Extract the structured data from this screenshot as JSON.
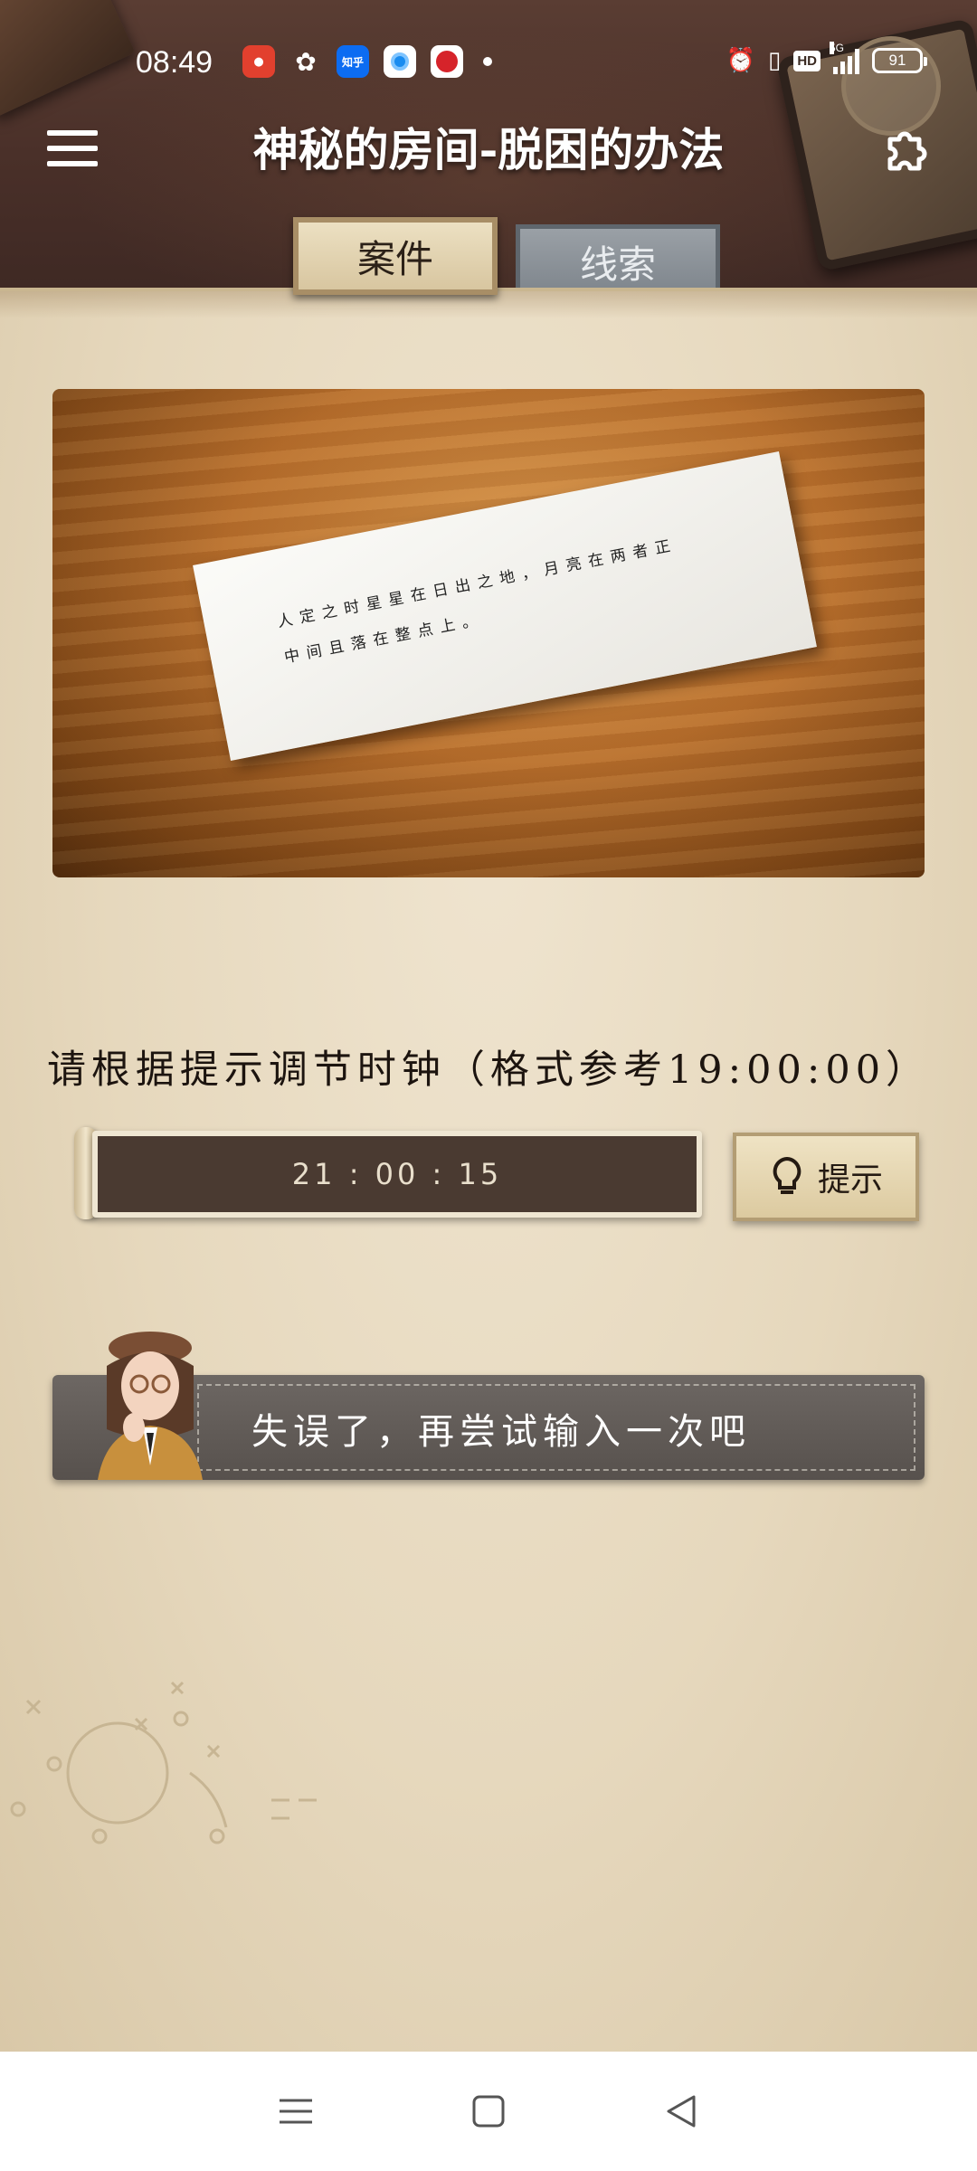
{
  "status_bar": {
    "time": "08:49",
    "apps": [
      "notification-app-icon",
      "wechat-icon",
      "zhihu-icon",
      "browser-icon",
      "bank-icon"
    ],
    "zhihu_label": "知乎",
    "network": "5G",
    "hd": "HD",
    "battery": "91"
  },
  "header": {
    "title": "神秘的房间-脱困的办法"
  },
  "tabs": [
    {
      "label": "案件",
      "active": true
    },
    {
      "label": "线索",
      "active": false
    }
  ],
  "case_note": {
    "line1": "人定之时星星在日出之地，月亮在两者正",
    "line2": "中间且落在整点上。"
  },
  "puzzle": {
    "instruction": "请根据提示调节时钟（格式参考19:00:00）",
    "time_value": "21 : 00 : 15",
    "hint_label": "提示"
  },
  "feedback": {
    "message": "失误了，再尝试输入一次吧"
  },
  "colors": {
    "desk": "#4a3029",
    "paper": "#e6d8bd",
    "input_bg": "#4a3a31",
    "banner": "#615b57"
  }
}
